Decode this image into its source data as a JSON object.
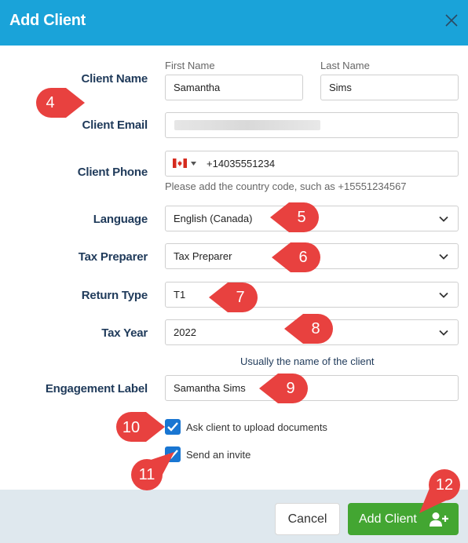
{
  "dialog": {
    "title": "Add Client"
  },
  "form": {
    "client_name_label": "Client Name",
    "first_name_label": "First Name",
    "last_name_label": "Last Name",
    "first_name_value": "Samantha",
    "last_name_value": "Sims",
    "client_email_label": "Client Email",
    "client_phone_label": "Client Phone",
    "phone_value": "+14035551234",
    "phone_hint": "Please add the country code, such as +15551234567",
    "language_label": "Language",
    "language_value": "English (Canada)",
    "tax_preparer_label": "Tax Preparer",
    "tax_preparer_value": "Tax Preparer",
    "return_type_label": "Return Type",
    "return_type_value": "T1",
    "tax_year_label": "Tax Year",
    "tax_year_value": "2022",
    "engagement_hint": "Usually the name of the client",
    "engagement_label": "Engagement Label",
    "engagement_value": "Samantha Sims",
    "ask_upload_label": "Ask client to upload documents",
    "send_invite_label": "Send an invite"
  },
  "footer": {
    "cancel_label": "Cancel",
    "add_client_label": "Add Client"
  },
  "markers": {
    "m4": "4",
    "m5": "5",
    "m6": "6",
    "m7": "7",
    "m8": "8",
    "m9": "9",
    "m10": "10",
    "m11": "11",
    "m12": "12"
  },
  "colors": {
    "header": "#1aa3d9",
    "label": "#1f3a5a",
    "marker": "#e8413f",
    "checkbox": "#1976d2",
    "primary_button": "#43a632",
    "footer": "#dfe8ee"
  }
}
